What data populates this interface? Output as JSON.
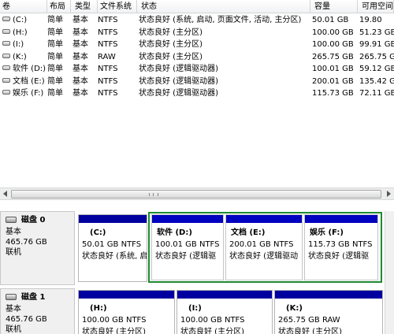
{
  "volume_list": {
    "columns": {
      "volume": "卷",
      "layout": "布局",
      "type": "类型",
      "filesystem": "文件系统",
      "status": "状态",
      "capacity": "容量",
      "free": "可用空间"
    },
    "rows": [
      {
        "volume": "(C:)",
        "layout": "简单",
        "type": "基本",
        "fs": "NTFS",
        "status": "状态良好 (系统, 启动, 页面文件, 活动, 主分区)",
        "capacity": "50.01 GB",
        "free": "19.80"
      },
      {
        "volume": "(H:)",
        "layout": "简单",
        "type": "基本",
        "fs": "NTFS",
        "status": "状态良好 (主分区)",
        "capacity": "100.00 GB",
        "free": "51.23 GB"
      },
      {
        "volume": "(I:)",
        "layout": "简单",
        "type": "基本",
        "fs": "NTFS",
        "status": "状态良好 (主分区)",
        "capacity": "100.00 GB",
        "free": "99.91 GB"
      },
      {
        "volume": "(K:)",
        "layout": "简单",
        "type": "基本",
        "fs": "RAW",
        "status": "状态良好 (主分区)",
        "capacity": "265.75 GB",
        "free": "265.75 G"
      },
      {
        "volume": "软件 (D:)",
        "layout": "简单",
        "type": "基本",
        "fs": "NTFS",
        "status": "状态良好 (逻辑驱动器)",
        "capacity": "100.01 GB",
        "free": "59.12 GB"
      },
      {
        "volume": "文档 (E:)",
        "layout": "简单",
        "type": "基本",
        "fs": "NTFS",
        "status": "状态良好 (逻辑驱动器)",
        "capacity": "200.01 GB",
        "free": "135.42 G"
      },
      {
        "volume": "娱乐 (F:)",
        "layout": "简单",
        "type": "基本",
        "fs": "NTFS",
        "status": "状态良好 (逻辑驱动器)",
        "capacity": "115.73 GB",
        "free": "72.11 GB"
      }
    ]
  },
  "disks": [
    {
      "title": "磁盘 0",
      "type": "基本",
      "size": "465.76 GB",
      "state": "联机",
      "partitions": [
        {
          "name": "(C:)",
          "size": "50.01 GB NTFS",
          "status": "状态良好 (系统, 启"
        },
        {
          "name": "软件  (D:)",
          "size": "100.01 GB NTFS",
          "status": "状态良好 (逻辑驱"
        },
        {
          "name": "文档  (E:)",
          "size": "200.01 GB NTFS",
          "status": "状态良好 (逻辑驱动"
        },
        {
          "name": "娱乐  (F:)",
          "size": "115.73 GB NTFS",
          "status": "状态良好 (逻辑驱"
        }
      ]
    },
    {
      "title": "磁盘 1",
      "type": "基本",
      "size": "465.76 GB",
      "state": "联机",
      "partitions": [
        {
          "name": "(H:)",
          "size": "100.00 GB NTFS",
          "status": "状态良好 (主分区)"
        },
        {
          "name": "(I:)",
          "size": "100.00 GB NTFS",
          "status": "状态良好 (主分区)"
        },
        {
          "name": "(K:)",
          "size": "265.75 GB RAW",
          "status": "状态良好 (主分区)"
        }
      ]
    }
  ],
  "colors": {
    "primary_bar": "#0000a0",
    "logical_bar": "#0000c0",
    "extended_frame": "#1f8a30"
  }
}
